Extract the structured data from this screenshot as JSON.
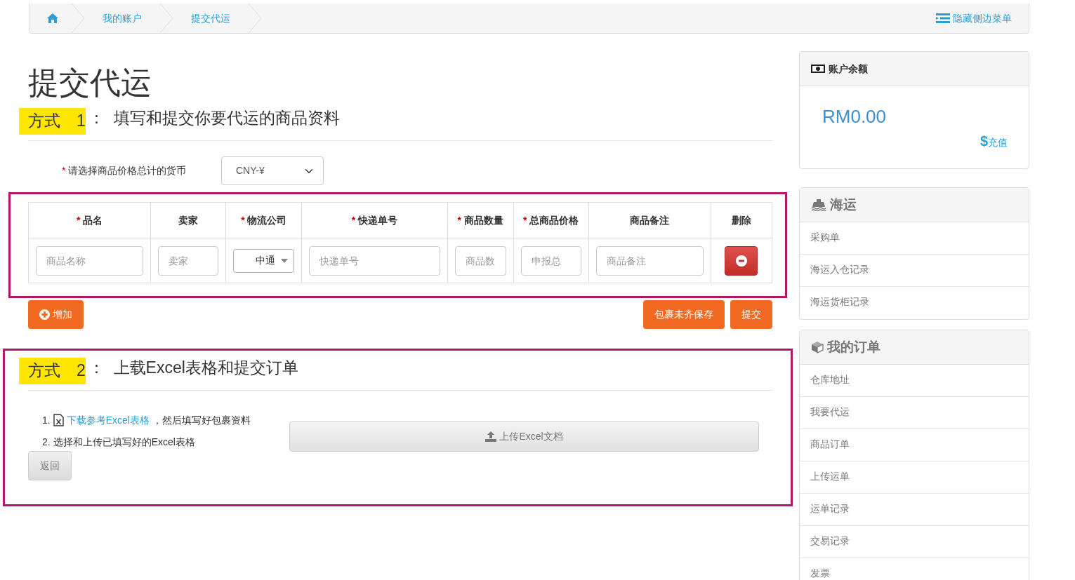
{
  "breadcrumb": {
    "items": [
      {
        "label": "我的账户"
      },
      {
        "label": "提交代运"
      }
    ],
    "toggle": "隐藏侧边菜单"
  },
  "page_title": "提交代运",
  "method1": {
    "highlight": "方式　1",
    "highlighted": true,
    "title": "：  填写和提交你要代运的商品资料",
    "currency": {
      "mark": "*",
      "label": "请选择商品价格总计的货币",
      "value": "CNY-¥"
    },
    "table": {
      "annotation_frame": true,
      "columns": [
        {
          "label": "品名",
          "mark": "*"
        },
        {
          "label": "卖家"
        },
        {
          "label": "物流公司",
          "mark": "*"
        },
        {
          "label": "快递单号",
          "mark": "*"
        },
        {
          "label": "商品数量",
          "mark": "*"
        },
        {
          "label": "总商品价格",
          "mark": "*"
        },
        {
          "label": "商品备注"
        },
        {
          "label": "删除"
        }
      ],
      "rows": [
        [
          {
            "kind": "input",
            "placeholder": "商品名称"
          },
          {
            "kind": "input",
            "placeholder": "卖家"
          },
          {
            "kind": "select",
            "value": "中通"
          },
          {
            "kind": "input",
            "placeholder": "快递单号"
          },
          {
            "kind": "input",
            "placeholder": "商品数"
          },
          {
            "kind": "input",
            "placeholder": "申报总"
          },
          {
            "kind": "input",
            "placeholder": "商品备注"
          },
          {
            "kind": "delete"
          }
        ]
      ]
    },
    "add_button": "增加",
    "save_button": "包裹未齐保存",
    "submit_button": "提交"
  },
  "method2": {
    "annotation_frame": true,
    "highlight": "方式　2",
    "highlighted": true,
    "title": "：  上载Excel表格和提交订单",
    "steps": [
      {
        "number": "1.",
        "link": "下载参考Excel表格",
        "text": "，然后填写好包裹资料"
      },
      {
        "number": "2.",
        "text": "选择和上传已填写好的Excel表格"
      }
    ],
    "upload_button": "上传Excel文档",
    "back_button": "返回"
  },
  "sidebar": {
    "balance": {
      "title": "账户余额",
      "amount": "RM0.00",
      "recharge_symbol": "$",
      "recharge": "充值"
    },
    "groups": [
      {
        "title": "海运",
        "items": [
          "采购单",
          "海运入仓记录",
          "海运货柜记录"
        ]
      },
      {
        "title": "我的订单",
        "items": [
          "仓库地址",
          "我要代运",
          "商品订单",
          "上传运单",
          "运单记录",
          "交易记录",
          "发票"
        ]
      }
    ]
  }
}
